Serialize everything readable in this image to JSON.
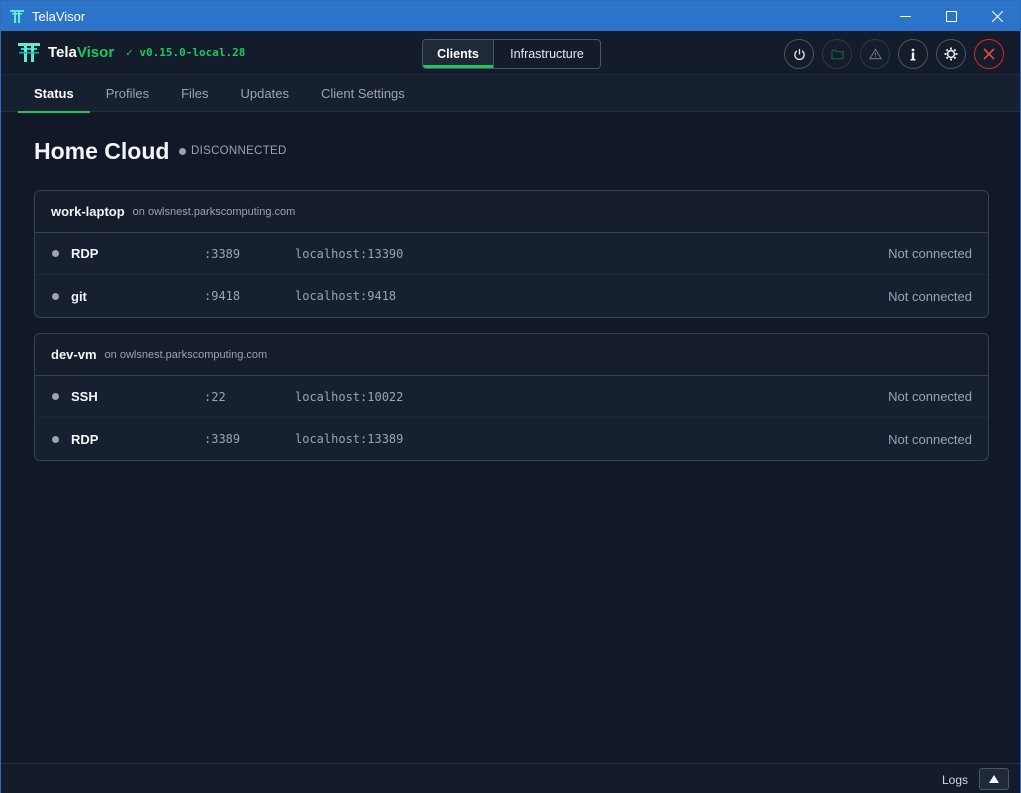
{
  "window": {
    "title": "TelaVisor"
  },
  "brand": {
    "name_part1": "Tela",
    "name_part2": "Visor",
    "version": "✓ v0.15.0-local.28"
  },
  "mode_switch": {
    "active": "Clients",
    "inactive": "Infrastructure"
  },
  "header_icons": [
    "power-icon",
    "folder-icon",
    "warning-icon",
    "info-icon",
    "gear-icon",
    "close-circle-icon"
  ],
  "tabs": [
    {
      "label": "Status",
      "active": true
    },
    {
      "label": "Profiles",
      "active": false
    },
    {
      "label": "Files",
      "active": false
    },
    {
      "label": "Updates",
      "active": false
    },
    {
      "label": "Client Settings",
      "active": false
    }
  ],
  "main": {
    "title": "Home Cloud",
    "status": "DISCONNECTED"
  },
  "machines": [
    {
      "name": "work-laptop",
      "host": "on owlsnest.parkscomputing.com",
      "services": [
        {
          "name": "RDP",
          "port": ":3389",
          "local": "localhost:13390",
          "state": "Not connected"
        },
        {
          "name": "git",
          "port": ":9418",
          "local": "localhost:9418",
          "state": "Not connected"
        }
      ]
    },
    {
      "name": "dev-vm",
      "host": "on owlsnest.parkscomputing.com",
      "services": [
        {
          "name": "SSH",
          "port": ":22",
          "local": "localhost:10022",
          "state": "Not connected"
        },
        {
          "name": "RDP",
          "port": ":3389",
          "local": "localhost:13389",
          "state": "Not connected"
        }
      ]
    }
  ],
  "footer": {
    "logs_label": "Logs"
  },
  "colors": {
    "accent": "#22c55e",
    "titlebar": "#2b74c9",
    "background": "#111827",
    "danger": "#dc2626"
  }
}
